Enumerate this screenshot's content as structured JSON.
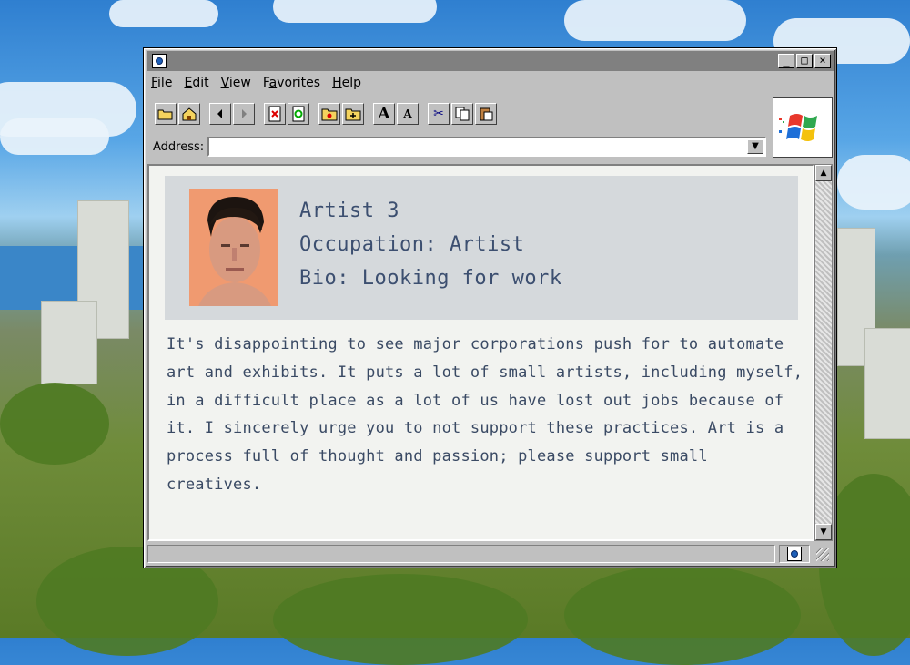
{
  "window": {
    "menu": [
      {
        "label": "File",
        "accel": "F",
        "rest": "ile"
      },
      {
        "label": "Edit",
        "accel": "E",
        "rest": "dit"
      },
      {
        "label": "View",
        "accel": "V",
        "rest": "iew"
      },
      {
        "label": "Favorites",
        "accel": "a",
        "pre": "F",
        "rest": "vorites"
      },
      {
        "label": "Help",
        "accel": "H",
        "rest": "elp"
      }
    ],
    "controls": {
      "minimize": "_",
      "maximize": "□",
      "close": "×"
    }
  },
  "toolbar": {
    "buttons": [
      {
        "name": "open-folder-icon"
      },
      {
        "name": "home-icon"
      },
      {
        "name": "back-arrow-icon"
      },
      {
        "name": "forward-arrow-icon"
      },
      {
        "name": "stop-icon"
      },
      {
        "name": "refresh-icon"
      },
      {
        "name": "favorites-folder-icon"
      },
      {
        "name": "add-favorites-icon"
      },
      {
        "name": "font-larger-icon",
        "glyph": "A"
      },
      {
        "name": "font-smaller-icon",
        "glyph": "A"
      },
      {
        "name": "cut-icon",
        "glyph": "✂"
      },
      {
        "name": "copy-icon"
      },
      {
        "name": "paste-icon"
      }
    ]
  },
  "address": {
    "label": "Address:",
    "value": ""
  },
  "profile": {
    "name": "Artist 3",
    "occupation": "Occupation: Artist",
    "bio": "Bio: Looking for work"
  },
  "message": "It's disappointing to see major corporations push for to automate art and exhibits. It puts a lot of small artists, including myself, in a difficult place as a lot of us have lost out jobs because of it. I sincerely urge you to not support these practices. Art is a process full of thought and passion; please support small creatives.",
  "colors": {
    "window": "#c0c0c0",
    "titlebar": "#808080",
    "content_bg": "#f2f3f0",
    "card_bg": "#d5d9dc",
    "text": "#3a4a64"
  }
}
